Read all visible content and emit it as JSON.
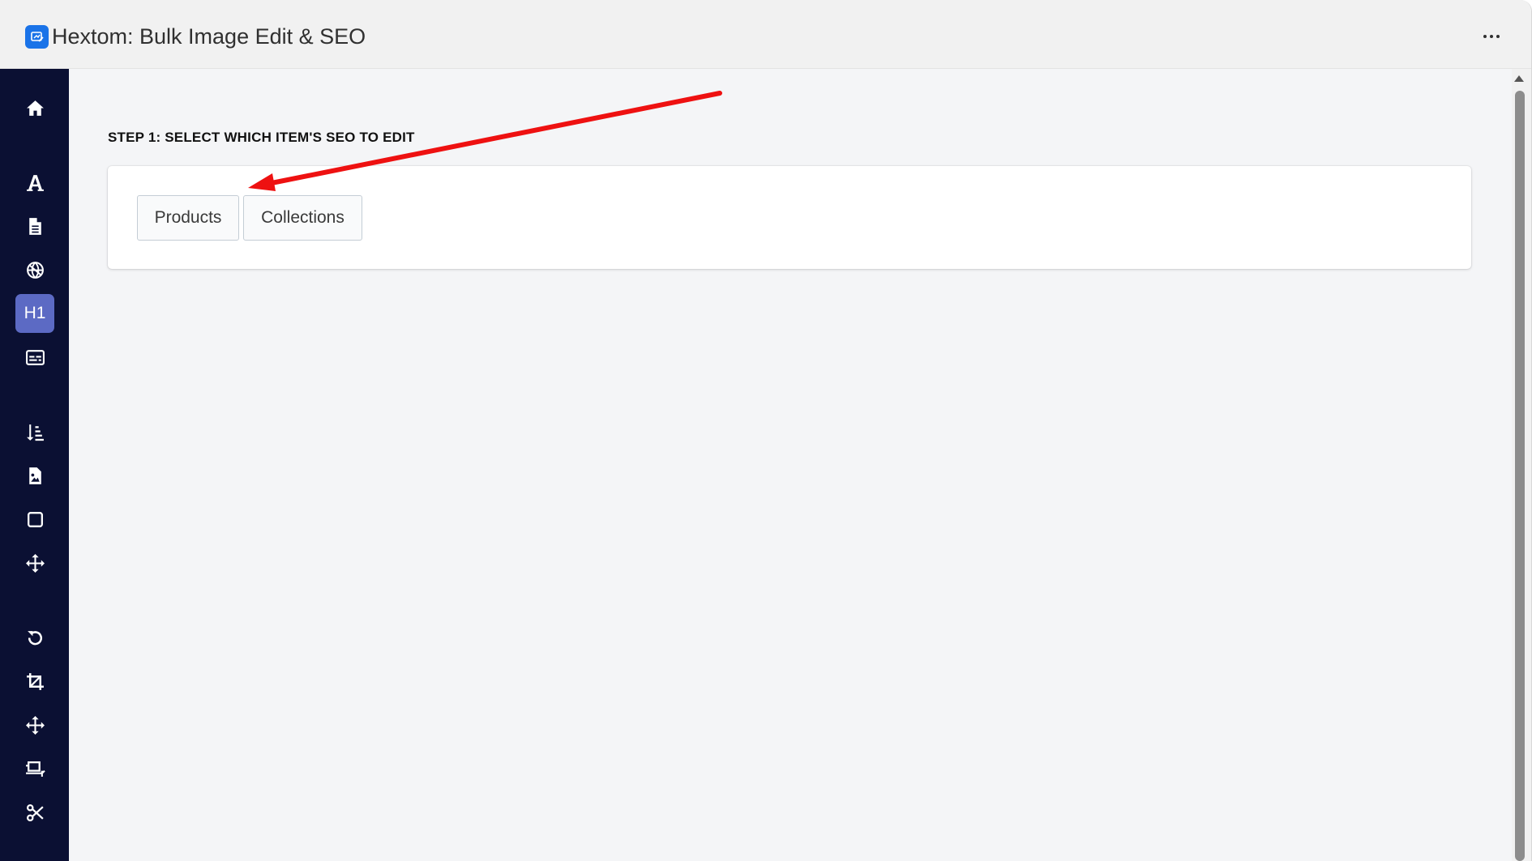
{
  "app": {
    "title": "Hextom: Bulk Image Edit & SEO",
    "logo_icon": "app-logo-icon",
    "more_icon": "more-horizontal-icon"
  },
  "sidebar": {
    "background": "#0b1033",
    "active_color": "#5c6ac4",
    "items": [
      {
        "icon": "home-icon",
        "label": ""
      },
      {
        "icon": "font-icon",
        "label": ""
      },
      {
        "icon": "file-icon",
        "label": ""
      },
      {
        "icon": "globe-icon",
        "label": ""
      },
      {
        "icon": "heading-icon",
        "label": "H1"
      },
      {
        "icon": "closed-captioning-icon",
        "label": ""
      },
      {
        "icon": "sort-icon",
        "label": ""
      },
      {
        "icon": "file-image-icon",
        "label": ""
      },
      {
        "icon": "square-icon",
        "label": ""
      },
      {
        "icon": "move-icon",
        "label": ""
      },
      {
        "icon": "rotate-icon",
        "label": ""
      },
      {
        "icon": "crop-icon",
        "label": ""
      },
      {
        "icon": "move-icon",
        "label": ""
      },
      {
        "icon": "resize-icon",
        "label": ""
      },
      {
        "icon": "scissors-icon",
        "label": ""
      }
    ]
  },
  "main": {
    "step_label": "STEP 1: SELECT WHICH ITEM'S SEO TO EDIT",
    "buttons": {
      "products": "Products",
      "collections": "Collections"
    }
  },
  "annotation": {
    "type": "arrow",
    "color": "#ee1111"
  }
}
